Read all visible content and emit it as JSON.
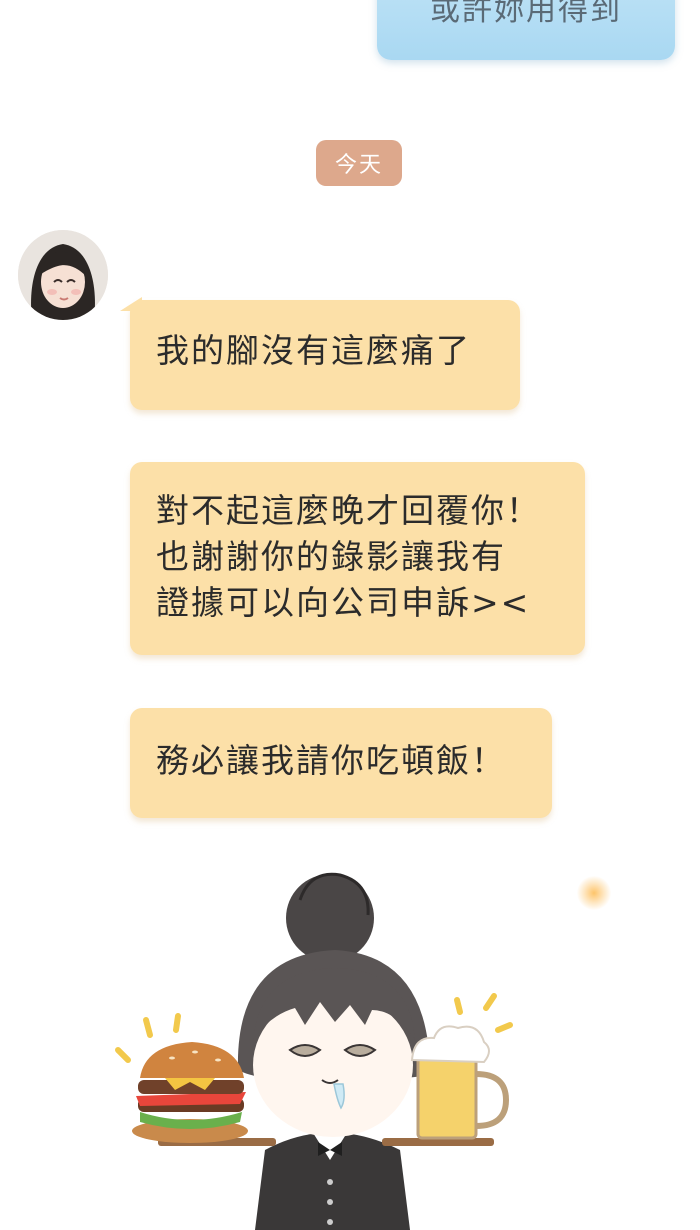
{
  "conversation": {
    "sent_message": "或許妳用得到",
    "date_divider": "今天",
    "received_messages": [
      {
        "lines": [
          "我的腳沒有這麼痛了"
        ]
      },
      {
        "lines": [
          "對不起這麼晚才回覆你！",
          "也謝謝你的錄影讓我有",
          "證據可以向公司申訴><"
        ]
      },
      {
        "lines": [
          "務必讓我請你吃頓飯！"
        ]
      }
    ]
  },
  "colors": {
    "sent_bubble": "#a9d8f2",
    "received_bubble": "#fce0a8",
    "date_chip": "#dda88c"
  },
  "illustration": {
    "subject": "chibi-waiter-holding-burger-and-beer"
  }
}
